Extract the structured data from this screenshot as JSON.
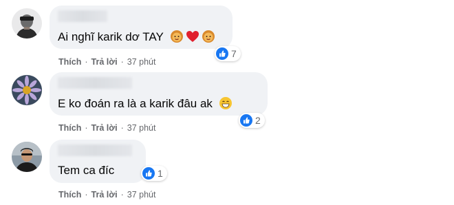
{
  "comments": [
    {
      "text": "Ai nghĩ karik dơ TAY",
      "emojis": [
        "blonde-face-emoji",
        "red-heart-emoji",
        "blonde-face-emoji"
      ],
      "reaction_count": "7",
      "reaction_icon": "like-icon",
      "like_label": "Thích",
      "reply_label": "Trả lời",
      "time": "37 phút"
    },
    {
      "text": "E ko đoán ra là a karik đâu ak",
      "emojis": [
        "grinning-face-emoji"
      ],
      "reaction_count": "2",
      "reaction_icon": "like-icon",
      "like_label": "Thích",
      "reply_label": "Trả lời",
      "time": "37 phút"
    },
    {
      "text": "Tem ca đíc",
      "emojis": [],
      "reaction_count": "1",
      "reaction_icon": "like-icon",
      "like_label": "Thích",
      "reply_label": "Trả lời",
      "time": "37 phút"
    }
  ],
  "colors": {
    "bubble": "#f0f2f5",
    "meta_text": "#65676b",
    "like_blue": "#1877f2"
  },
  "separator": "·"
}
